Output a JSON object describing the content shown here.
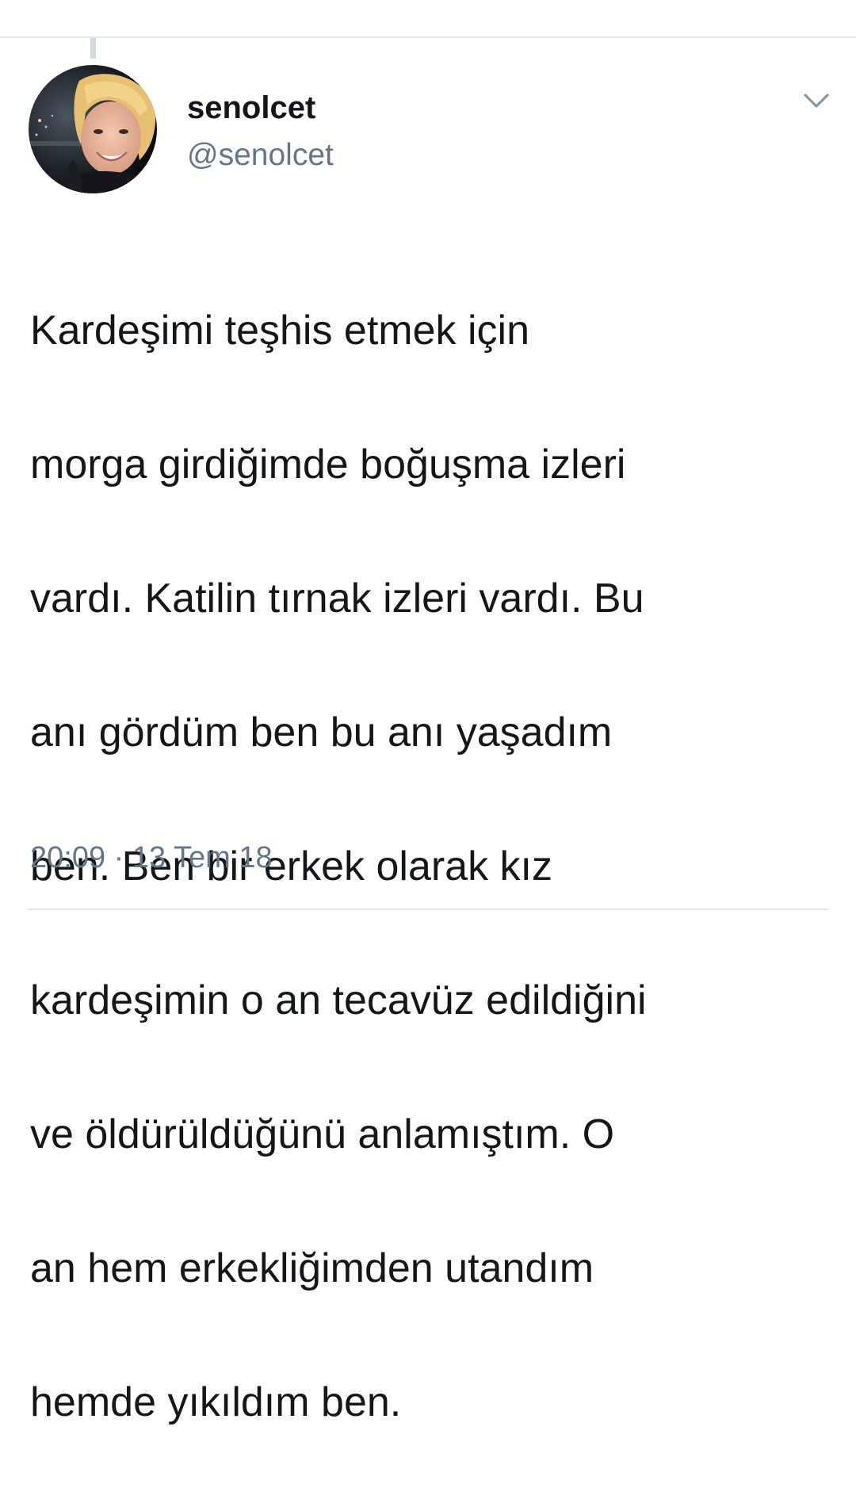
{
  "tweet": {
    "display_name": "senolcet",
    "handle": "@senolcet",
    "text_lines": [
      "Kardeşimi teşhis etmek için",
      "morga girdiğimde boğuşma izleri",
      "vardı. Katilin tırnak izleri vardı. Bu",
      "anı gördüm ben bu anı yaşadım",
      "ben. Ben bir erkek olarak kız",
      "kardeşimin o an tecavüz edildiğini",
      "ve öldürüldüğünü anlamıştım. O",
      "an hem erkekliğimden utandım",
      "hemde yıkıldım ben."
    ],
    "timestamp": "20:09 · 13 Tem 18"
  },
  "icons": {
    "menu": "chevron-down-icon",
    "avatar": "profile-photo"
  },
  "colors": {
    "text_primary": "#14171a",
    "text_secondary": "#657786",
    "divider": "#e1e8ed",
    "chevron": "#8899a6"
  }
}
